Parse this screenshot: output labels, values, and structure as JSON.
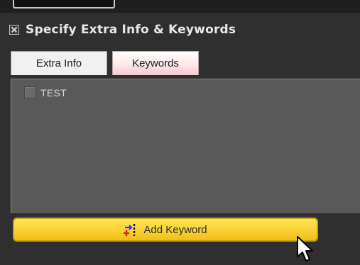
{
  "header": {
    "title": "Specify Extra Info & Keywords",
    "collapse_icon": "collapse-x-icon"
  },
  "tabs": [
    {
      "label": "Extra Info",
      "active": false
    },
    {
      "label": "Keywords",
      "active": true
    }
  ],
  "keywords": {
    "items": [
      {
        "label": "TEST",
        "checked": false
      }
    ]
  },
  "add_keyword_button": {
    "label": "Add Keyword",
    "icon": "add-keyword-icon"
  },
  "colors": {
    "panel_background": "#2f2f2f",
    "list_background": "#595959",
    "button_yellow": "#f9cf2d",
    "active_tab_pink": "#f7c8cf"
  }
}
